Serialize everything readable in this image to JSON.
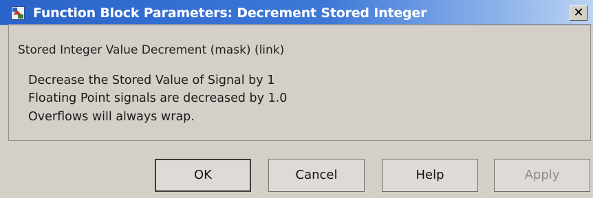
{
  "window": {
    "title": "Function Block Parameters: Decrement Stored Integer",
    "close_label": "✕"
  },
  "group": {
    "legend": "Stored Integer Value Decrement (mask) (link)",
    "description_lines": [
      "Decrease the Stored Value of Signal by 1",
      "Floating Point signals are decreased by 1.0",
      "Overflows will always wrap."
    ]
  },
  "buttons": {
    "ok": "OK",
    "cancel": "Cancel",
    "help": "Help",
    "apply": "Apply"
  },
  "icons": {
    "app": "simulink-block-icon",
    "close": "close-icon"
  }
}
